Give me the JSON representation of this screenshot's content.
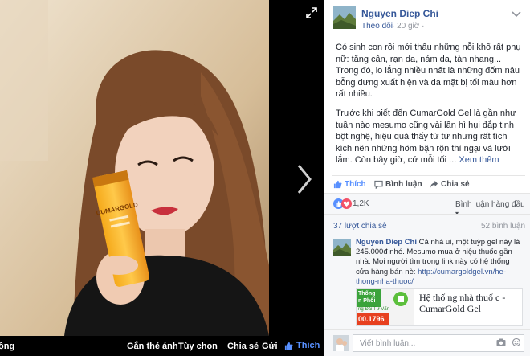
{
  "viewer": {
    "bottom_bar": {
      "left_cut": "ộng",
      "tag": "Gắn thẻ ảnh",
      "options": "Tùy chọn",
      "share": "Chia sẻ",
      "send": "Gửi",
      "like": "Thích"
    },
    "product_label": "CUMARGOLD"
  },
  "post": {
    "author": "Nguyen Diep Chi",
    "follow": "Theo dõi",
    "time": "· 20 giờ ·",
    "body": [
      "Có sinh con rồi mới thấu những nỗi khổ rất phụ nữ: tăng cân, rạn da, nám da, tàn nhang... Trong đó, lo lắng nhiều nhất là những đốm nâu bỗng dưng xuất hiện và da mặt bị tối màu hơn rất nhiều.",
      "Trước khi biết đến CumarGold Gel là gần như tuần nào mesumo cũng vài lần hì hụi đắp tinh bột nghệ, hiệu quả thấy từ từ nhưng rất tích kích nên những hôm bận rộn thì ngại và lười lắm. Còn bây giờ, cứ mỗi tối ..."
    ],
    "see_more": "Xem thêm",
    "actions": {
      "like": "Thích",
      "comment": "Bình luận",
      "share": "Chia sẻ"
    },
    "reactions": {
      "count": "1,2K",
      "sort": "Bình luận hàng đầu"
    },
    "stats": {
      "shares": "37 lượt chia sẻ",
      "comments": "52 bình luận"
    }
  },
  "comment": {
    "author": "Nguyen Diep Chi",
    "text": " Cả nhà ui, một tuýp gel này là 245.000đ nhé. Mesumo mua ở hiệu thuốc gần nhà. Mọi người tìm trong link này có hệ thống cửa hàng bán nè: ",
    "link": "http://cumargoldgel.vn/he-thong-nha-thuoc/",
    "preview": {
      "title": "Hệ thố ng nhà thuố c - CumarGold Gel",
      "img_line1": "Thống",
      "img_line2": "n Phối",
      "img_line3": "ng Đài Tư Vấn",
      "img_phone": "00.1796"
    }
  },
  "compose": {
    "placeholder": "Viết bình luận..."
  },
  "colors": {
    "link": "#365899",
    "panel_bg": "#f6f7f9",
    "like_blue": "#5890ff"
  }
}
